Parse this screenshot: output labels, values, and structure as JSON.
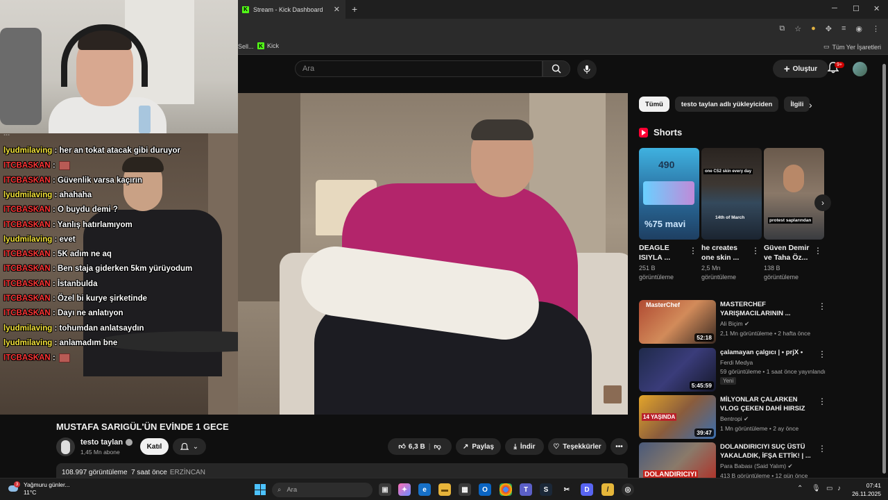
{
  "browser": {
    "tab_title": "Stream - Kick Dashboard",
    "tab_close": "✕",
    "new_tab": "+",
    "window_controls": [
      "─",
      "☐",
      "✕"
    ],
    "bookmarks": [
      {
        "label": "Sell..."
      },
      {
        "label": "Kick"
      }
    ],
    "bookmarks_right": "Tüm Yer İşaretleri"
  },
  "header": {
    "search_placeholder": "Ara",
    "create_label": "Oluştur",
    "notifications_badge": "9+"
  },
  "chat": {
    "partial_top": "...",
    "lines": [
      {
        "user": "lyudmilaving",
        "type": "lyud",
        "message": "her an tokat atacak gibi duruyor"
      },
      {
        "user": "ITCBASKAN",
        "type": "itc",
        "message": "",
        "emote": true
      },
      {
        "user": "ITCBASKAN",
        "type": "itc",
        "message": "Güvenlik varsa kaçırın"
      },
      {
        "user": "lyudmilaving",
        "type": "lyud",
        "message": "ahahaha"
      },
      {
        "user": "ITCBASKAN",
        "type": "itc",
        "message": "O buydu demi ?"
      },
      {
        "user": "ITCBASKAN",
        "type": "itc",
        "message": "Yanlış hatırlamıyom"
      },
      {
        "user": "lyudmilaving",
        "type": "lyud",
        "message": "evet"
      },
      {
        "user": "ITCBASKAN",
        "type": "itc",
        "message": "5K adım ne aq"
      },
      {
        "user": "ITCBASKAN",
        "type": "itc",
        "message": "Ben staja giderken 5km yürüyodum"
      },
      {
        "user": "ITCBASKAN",
        "type": "itc",
        "message": "İstanbulda"
      },
      {
        "user": "ITCBASKAN",
        "type": "itc",
        "message": "Özel bi kurye şirketinde"
      },
      {
        "user": "ITCBASKAN",
        "type": "itc",
        "message": "Dayı ne anlatıyon"
      },
      {
        "user": "lyudmilaving",
        "type": "lyud",
        "message": "tohumdan anlatsaydın"
      },
      {
        "user": "lyudmilaving",
        "type": "lyud",
        "message": "anlamadım bne"
      },
      {
        "user": "ITCBASKAN",
        "type": "itc",
        "message": "",
        "emote": true
      }
    ]
  },
  "video": {
    "title": "MUSTAFA SARIGÜL'ÜN EVİNDE 1 GECE",
    "channel": "testo taylan",
    "subscribers": "1,45 Mn abone",
    "join_label": "Katıl",
    "likes": "6,3 B",
    "share_label": "Paylaş",
    "download_label": "İndir",
    "thanks_label": "Teşekkürler",
    "more_label": "•••",
    "views": "108.997 görüntüleme",
    "time_ago": "7 saat önce",
    "location": "ERZİNCAN"
  },
  "sidebar": {
    "chips": [
      "Tümü",
      "testo taylan adlı yükleyiciden",
      "İlgili"
    ],
    "shorts_heading": "Shorts",
    "shorts": [
      {
        "title": "DEAGLE ISIYLA ...",
        "views_line1": "251 B",
        "views_line2": "görüntüleme",
        "thumb_text_top": "490",
        "thumb_text_bottom": "%75 mavi"
      },
      {
        "title": "he creates one skin ...",
        "views_line1": "2,5 Mn",
        "views_line2": "görüntüleme",
        "thumb_text_top": "one CS2 skin every day",
        "thumb_text_bottom": "14th of March"
      },
      {
        "title": "Güven Demir ve Taha Öz...",
        "views_line1": "138 B",
        "views_line2": "görüntüleme",
        "thumb_text_top": "",
        "thumb_text_bottom": "protest saplarından"
      }
    ],
    "recommended": [
      {
        "title": "MASTERCHEF YARIŞMACILARININ ...",
        "channel": "Ali Biçim",
        "verified": true,
        "meta": "2,1 Mn görüntüleme • 2 hafta önce",
        "duration": "52:18",
        "new_badge": "",
        "thumb_label": "MasterChef"
      },
      {
        "title": "çalamayan çalgıcı | • prjX •",
        "channel": "Ferdi Medya",
        "verified": false,
        "meta": "59 görüntüleme • 1 saat önce yayınlandı",
        "duration": "5:45:59",
        "new_badge": "Yeni",
        "thumb_label": ""
      },
      {
        "title": "MİLYONLAR ÇALARKEN VLOG ÇEKEN DAHİ HIRSIZ",
        "channel": "Bentropi",
        "verified": true,
        "meta": "1 Mn görüntüleme • 2 ay önce",
        "duration": "39:47",
        "new_badge": "",
        "thumb_label": "14 YAŞINDA"
      },
      {
        "title": "DOLANDIRICIYI SUÇ ÜSTÜ YAKALADIK, İFŞA ETTİK! | ...",
        "channel": "Para Babası (Said Yalım)",
        "verified": true,
        "meta": "413 B görüntüleme • 12 gün önce",
        "duration": "",
        "new_badge": "",
        "thumb_label": "DOLANDIRICIYI"
      }
    ]
  },
  "taskbar": {
    "weather_text": "Yağmuru günler...",
    "weather_temp": "11°C",
    "weather_badge": "3",
    "search_placeholder": "Ara",
    "time": "07:41",
    "date": "26.11.2025"
  },
  "colors": {
    "background": "#0f0f0f",
    "kick_green": "#53fc18",
    "chat_lyud": "#f5e43a",
    "chat_itc": "#ff3636",
    "yt_red": "#ff0033"
  }
}
